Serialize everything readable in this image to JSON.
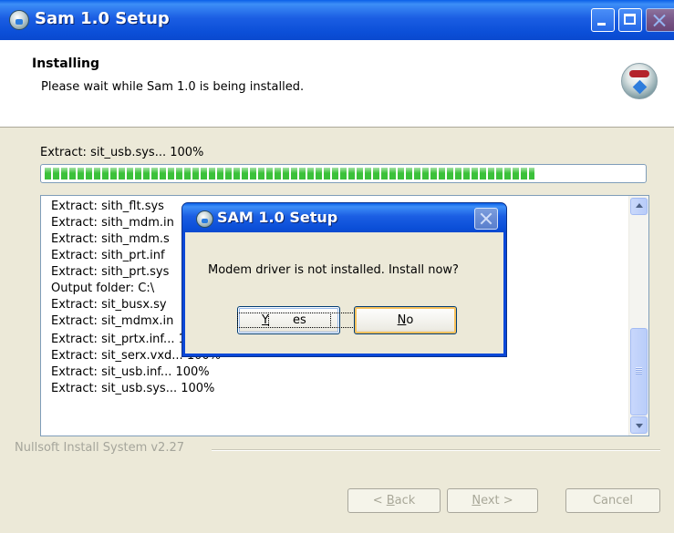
{
  "window": {
    "title": "Sam 1.0 Setup"
  },
  "header": {
    "title": "Installing",
    "subtitle": "Please wait while Sam 1.0 is being installed."
  },
  "progress": {
    "status_text": "Extract: sit_usb.sys... 100%",
    "value": 0.82,
    "color": "#3bc13a"
  },
  "log": {
    "lines": [
      "Extract: sith_flt.sys",
      "Extract: sith_mdm.in",
      "Extract: sith_mdm.s",
      "Extract: sith_prt.inf",
      "Extract: sith_prt.sys",
      "Output folder: C:\\",
      "Extract: sit_busx.sy",
      "Extract: sit_mdmx.in",
      "Extract: sit_prtx.inf... 100%",
      "Extract: sit_serx.vxd... 100%",
      "Extract: sit_usb.inf... 100%",
      "Extract: sit_usb.sys... 100%"
    ]
  },
  "footer": {
    "branding": "Nullsoft Install System v2.27",
    "back_label": "< ",
    "back_mnemonic": "B",
    "back_rest": "ack",
    "next_mnemonic": "N",
    "next_rest": "ext >",
    "cancel_label": "Cancel"
  },
  "dialog": {
    "title": "SAM 1.0 Setup",
    "message": "Modem driver is not installed. Install now?",
    "yes_mnemonic": "Y",
    "yes_rest": "es",
    "no_mnemonic": "N",
    "no_rest": "o"
  },
  "colors": {
    "title_bar": "#0b4fd8",
    "window_bg": "#ece9d8",
    "progress_fill": "#3bc13a"
  },
  "icons": [
    "setup-app-icon",
    "installer-disc-icon",
    "minimize-icon",
    "maximize-icon",
    "close-icon",
    "scroll-up-arrow-icon",
    "scroll-down-arrow-icon"
  ]
}
